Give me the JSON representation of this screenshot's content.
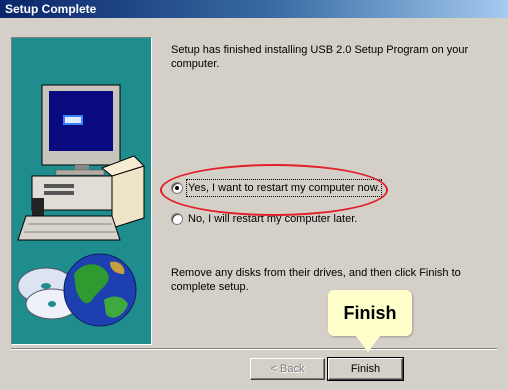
{
  "window": {
    "title": "Setup Complete"
  },
  "message": {
    "top": "Setup has finished installing USB 2.0 Setup Program on your computer.",
    "bottom": "Remove any disks from their drives, and then click Finish to complete setup."
  },
  "options": {
    "restart_now": "Yes, I want to restart my computer now.",
    "restart_later": "No, I will restart my computer later.",
    "selected": "restart_now"
  },
  "buttons": {
    "back": "< Back",
    "finish": "Finish"
  },
  "callout": {
    "text": "Finish"
  },
  "colors": {
    "panel": "#1f8d8d",
    "titlebar": "#0a246a",
    "highlight": "#e0202a",
    "callout": "#ffffcc"
  }
}
